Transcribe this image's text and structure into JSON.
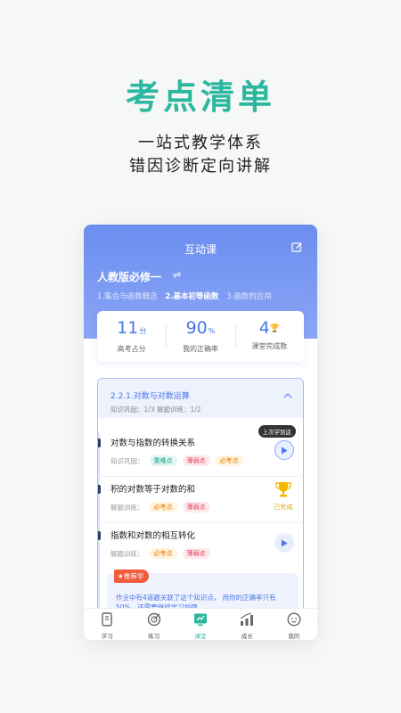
{
  "promo": {
    "headline": "考点清单",
    "line1": "一站式教学体系",
    "line2": "错因诊断定向讲解"
  },
  "app": {
    "title": "互动课",
    "book": "人教版必修一",
    "chapters": [
      "1.集合与函数概念",
      "2.基本初等函数",
      "3.函数的应用"
    ],
    "active_chapter": 1
  },
  "stats": [
    {
      "value": "11",
      "unit": "分",
      "label": "高考占分"
    },
    {
      "value": "90",
      "unit": "%",
      "label": "我的正确率"
    },
    {
      "value": "4",
      "unit": "",
      "label": "课堂完成数"
    }
  ],
  "section": {
    "title": "2.2.1.对数与对数运算",
    "progress": "知识巩固：1/3   解题训练：1/2"
  },
  "items": [
    {
      "title": "对数与指数的转换关系",
      "meta": "知识巩固：",
      "tags": [
        {
          "text": "重难点",
          "type": "diff"
        },
        {
          "text": "薄弱点",
          "type": "weak"
        },
        {
          "text": "必考点",
          "type": "key"
        }
      ],
      "status": "play-active",
      "tooltip": "上次学到这"
    },
    {
      "title": "积的对数等于对数的和",
      "meta": "解题训练：",
      "tags": [
        {
          "text": "必考点",
          "type": "key"
        },
        {
          "text": "薄弱点",
          "type": "weak"
        }
      ],
      "status": "done",
      "done_label": "已完成"
    },
    {
      "title": "指数和对数的相互转化",
      "meta": "解题训练：",
      "tags": [
        {
          "text": "必考点",
          "type": "key"
        },
        {
          "text": "薄弱点",
          "type": "weak"
        }
      ],
      "status": "play"
    }
  ],
  "recommend": {
    "badge": "推荐学",
    "text": "作业中有4道题关联了这个知识点， 而你的正确率只有50%，还需要继续学习加强"
  },
  "tabs": [
    {
      "label": "学习",
      "icon": "book-icon"
    },
    {
      "label": "练习",
      "icon": "target-icon"
    },
    {
      "label": "课堂",
      "icon": "classroom-icon",
      "active": true
    },
    {
      "label": "成长",
      "icon": "growth-chart-icon"
    },
    {
      "label": "我的",
      "icon": "profile-face-icon"
    }
  ],
  "colors": {
    "brand_teal": "#2cb89e",
    "header_blue": "#6c8df0",
    "accent_blue": "#4a76e8"
  }
}
